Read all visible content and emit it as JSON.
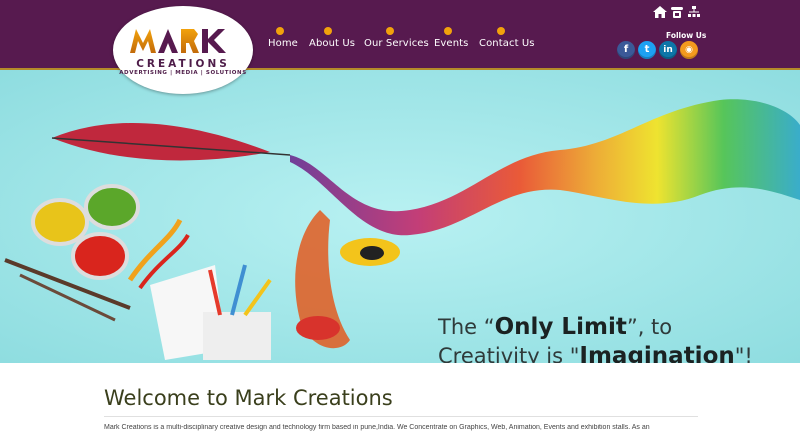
{
  "header": {
    "logo": {
      "mark": "MARK",
      "name": "CREATIONS",
      "tagline": "ADVERTISING | MEDIA | SOLUTIONS"
    },
    "nav": [
      {
        "label": "Home"
      },
      {
        "label": "About Us"
      },
      {
        "label": "Our Services"
      },
      {
        "label": "Events"
      },
      {
        "label": "Contact Us"
      }
    ],
    "utility_icons": [
      "home-icon",
      "phone-icon",
      "sitemap-icon"
    ],
    "follow_label": "Follow Us",
    "social": [
      {
        "name": "facebook-icon",
        "glyph": "f",
        "color": "#3b5998"
      },
      {
        "name": "twitter-icon",
        "glyph": "t",
        "color": "#1da1f2"
      },
      {
        "name": "linkedin-icon",
        "glyph": "in",
        "color": "#0e76a8"
      },
      {
        "name": "rss-icon",
        "glyph": "◉",
        "color": "#f39a1e"
      }
    ],
    "colors": {
      "bar": "#571a4f",
      "accent": "#f2a20c"
    }
  },
  "banner": {
    "quote_line1_a": "The “",
    "quote_line1_b": "Only Limit",
    "quote_line1_c": "”, to",
    "quote_line2_a": "Creativity is \"",
    "quote_line2_b": "Imagination",
    "quote_line2_c": "\"!",
    "background": "#9fe6e8"
  },
  "main": {
    "heading": "Welcome to Mark Creations",
    "intro": "Mark Creations is a multi-disciplinary creative design and technology firm based in pune,India. We Concentrate on Graphics, Web, Animation, Events and exhibition stalls. As an"
  }
}
